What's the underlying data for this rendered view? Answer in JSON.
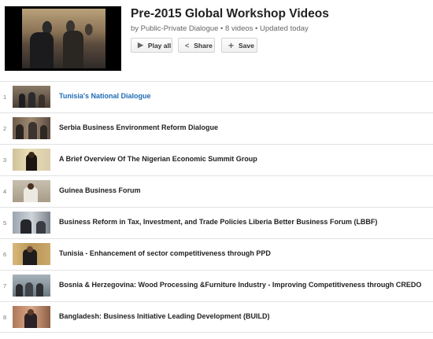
{
  "playlist": {
    "title": "Pre-2015 Global Workshop Videos",
    "meta": "by Public-Private Dialogue • 8 videos • Updated today",
    "buttons": {
      "play_all": "Play all",
      "share": "Share",
      "save": "Save"
    }
  },
  "videos": [
    {
      "index": "1",
      "title": "Tunisia's National Dialogue",
      "active": true
    },
    {
      "index": "2",
      "title": "Serbia Business Environment Reform Dialogue"
    },
    {
      "index": "3",
      "title": "A Brief Overview Of The Nigerian Economic Summit Group"
    },
    {
      "index": "4",
      "title": "Guinea Business Forum"
    },
    {
      "index": "5",
      "title": "Business Reform in Tax, Investment, and Trade Policies Liberia Better Business Forum (LBBF)"
    },
    {
      "index": "6",
      "title": "Tunisia - Enhancement of sector competitiveness through PPD"
    },
    {
      "index": "7",
      "title": "Bosnia & Herzegovina: Wood Processing &Furniture Industry - Improving Competitiveness through CREDO"
    },
    {
      "index": "8",
      "title": "Bangladesh: Business Initiative Leading Development (BUILD)"
    }
  ],
  "icons": {
    "play": "play-icon",
    "share": "share-icon",
    "save": "plus-icon"
  },
  "colors": {
    "active_title": "#1f6cb6"
  }
}
